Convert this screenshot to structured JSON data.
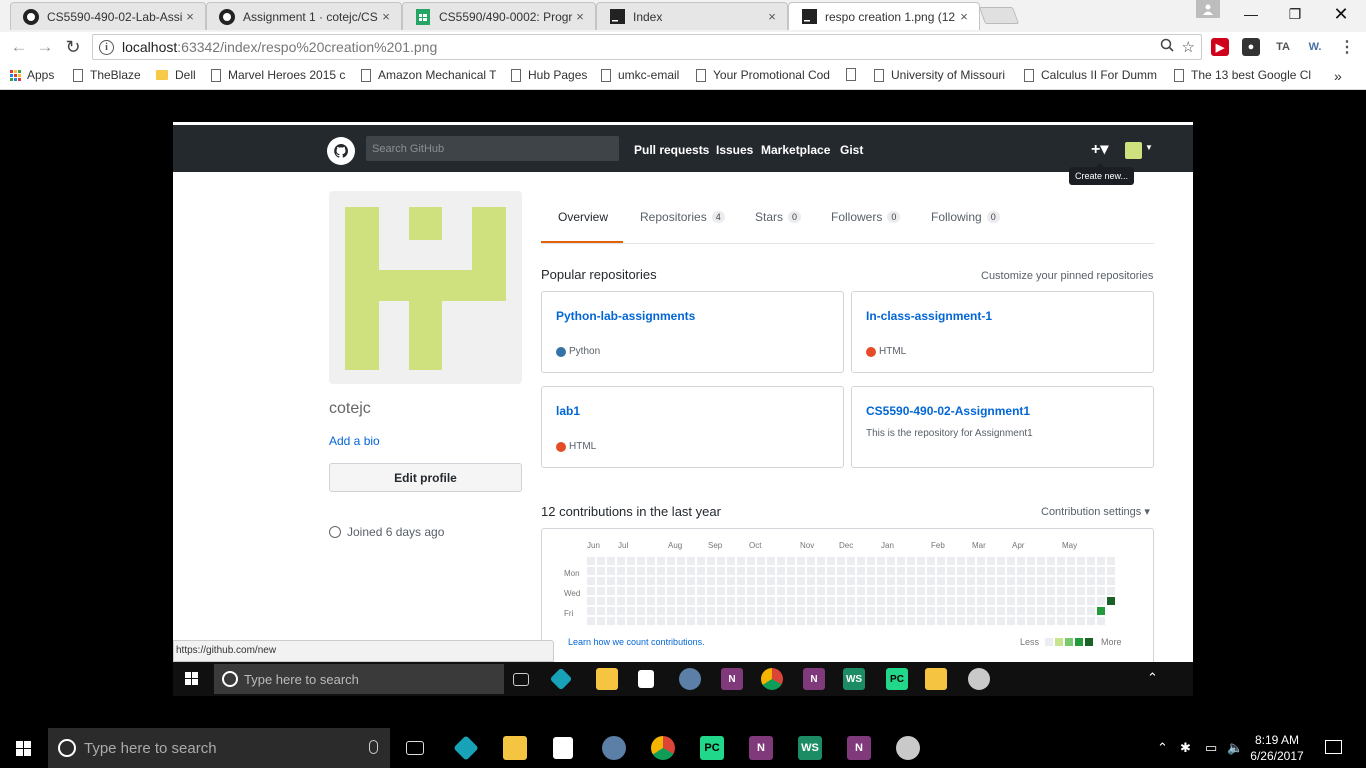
{
  "browser": {
    "tabs": [
      {
        "title": "CS5590-490-02-Lab-Assi",
        "icon": "github-icon",
        "active": false
      },
      {
        "title": "Assignment 1 · cotejc/CS",
        "icon": "github-icon",
        "active": false
      },
      {
        "title": "CS5590/490-0002: Progr",
        "icon": "sheets-icon",
        "active": false
      },
      {
        "title": "Index",
        "icon": "webstorm-icon",
        "active": false
      },
      {
        "title": "respo creation 1.png (12",
        "icon": "webstorm-icon",
        "active": true
      }
    ],
    "close_glyph": "×",
    "url_host": "localhost",
    "url_path": ":63342/index/respo%20creation%201.png",
    "extensions": [
      "TA",
      "W."
    ],
    "bookmarks": [
      {
        "label": "Apps",
        "type": "apps"
      },
      {
        "label": "TheBlaze",
        "type": "page"
      },
      {
        "label": "Dell",
        "type": "folder"
      },
      {
        "label": "Marvel Heroes 2015 c",
        "type": "page"
      },
      {
        "label": "Amazon Mechanical T",
        "type": "page"
      },
      {
        "label": "Hub Pages",
        "type": "page"
      },
      {
        "label": "umkc-email",
        "type": "page"
      },
      {
        "label": "Your Promotional Cod",
        "type": "page"
      },
      {
        "label": "",
        "type": "page"
      },
      {
        "label": "University of Missouri",
        "type": "page"
      },
      {
        "label": "Calculus II For Dumm",
        "type": "page"
      },
      {
        "label": "The 13 best Google Cl",
        "type": "page"
      }
    ],
    "more_bookmarks": "»"
  },
  "github": {
    "search_placeholder": "Search GitHub",
    "nav": [
      "Pull requests",
      "Issues",
      "Marketplace",
      "Gist"
    ],
    "plus": "+▾",
    "tooltip": "Create new...",
    "username": "cotejc",
    "add_bio": "Add a bio",
    "edit_profile": "Edit profile",
    "joined": "Joined 6 days ago",
    "tabs": [
      {
        "label": "Overview",
        "count": ""
      },
      {
        "label": "Repositories",
        "count": "4"
      },
      {
        "label": "Stars",
        "count": "0"
      },
      {
        "label": "Followers",
        "count": "0"
      },
      {
        "label": "Following",
        "count": "0"
      }
    ],
    "popular_title": "Popular repositories",
    "customize": "Customize your pinned repositories",
    "repos": [
      {
        "name": "Python-lab-assignments",
        "desc": "",
        "lang": "Python",
        "color": "#3572A5"
      },
      {
        "name": "In-class-assignment-1",
        "desc": "",
        "lang": "HTML",
        "color": "#e34c26"
      },
      {
        "name": "lab1",
        "desc": "",
        "lang": "HTML",
        "color": "#e34c26"
      },
      {
        "name": "CS5590-490-02-Assignment1",
        "desc": "This is the repository for Assignment1",
        "lang": "",
        "color": ""
      }
    ],
    "contrib_title": "12 contributions in the last year",
    "contrib_settings": "Contribution settings ▾",
    "months": [
      "Jun",
      "Jul",
      "Aug",
      "Sep",
      "Oct",
      "Nov",
      "Dec",
      "Jan",
      "Feb",
      "Mar",
      "Apr",
      "May"
    ],
    "days": [
      "Mon",
      "Wed",
      "Fri"
    ],
    "learn_link": "Learn how we count contributions.",
    "less": "Less",
    "more": "More",
    "legend_colors": [
      "#ebedf0",
      "#c6e48b",
      "#7bc96f",
      "#239a3b",
      "#196127"
    ],
    "status_url": "https://github.com/new"
  },
  "inner_taskbar": {
    "search_placeholder": "Type here to search",
    "apps": [
      "K",
      "",
      "",
      "",
      "N",
      "",
      "N",
      "WS",
      "PC",
      "",
      ""
    ]
  },
  "taskbar": {
    "search_placeholder": "Type here to search",
    "apps": [
      "K",
      "",
      "",
      "",
      "",
      "PC",
      "N",
      "WS",
      "N",
      ""
    ],
    "time": "8:19 AM",
    "date": "6/26/2017"
  }
}
